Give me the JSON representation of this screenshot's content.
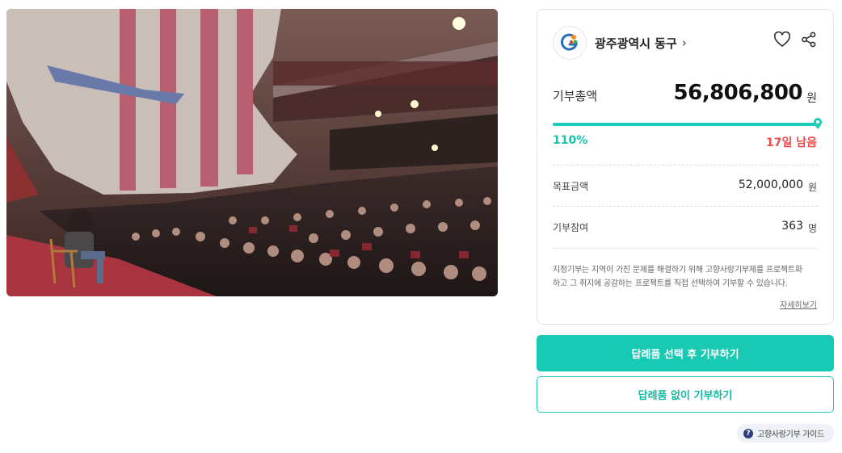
{
  "photo": {
    "alt": "theater audience"
  },
  "org": {
    "name": "광주광역시 동구",
    "chevron": "›",
    "logo_icon": "gwangju-donggu-logo"
  },
  "actions": {
    "like_icon": "heart-icon",
    "share_icon": "share-icon"
  },
  "funding": {
    "total_label": "기부총액",
    "total_amount": "56,806,800",
    "currency_unit": "원",
    "progress_fraction": 1.0,
    "percent_text": "110%",
    "remaining_text": "17일 남음",
    "goal_label": "목표금액",
    "goal_value": "52,000,000",
    "goal_unit": "원",
    "participants_label": "기부참여",
    "participants_value": "363",
    "participants_unit": "명"
  },
  "description": {
    "line1": "지정기부는 지역이 가진 문제를 해결하기 위해 고향사랑기부제를 프로젝트화",
    "line2": "하고 그 취지에 공감하는 프로젝트를 직접 선택하여 기부할 수 있습니다.",
    "more_link": "자세히보기"
  },
  "buttons": {
    "primary": "답례품 선택 후 기부하기",
    "secondary": "답례품 없이 기부하기"
  },
  "guide": {
    "icon_text": "?",
    "label": "고향사랑기부 가이드"
  },
  "colors": {
    "accent": "#18c9b4",
    "percent": "#18c3ad",
    "remaining": "#ee4b4b"
  }
}
